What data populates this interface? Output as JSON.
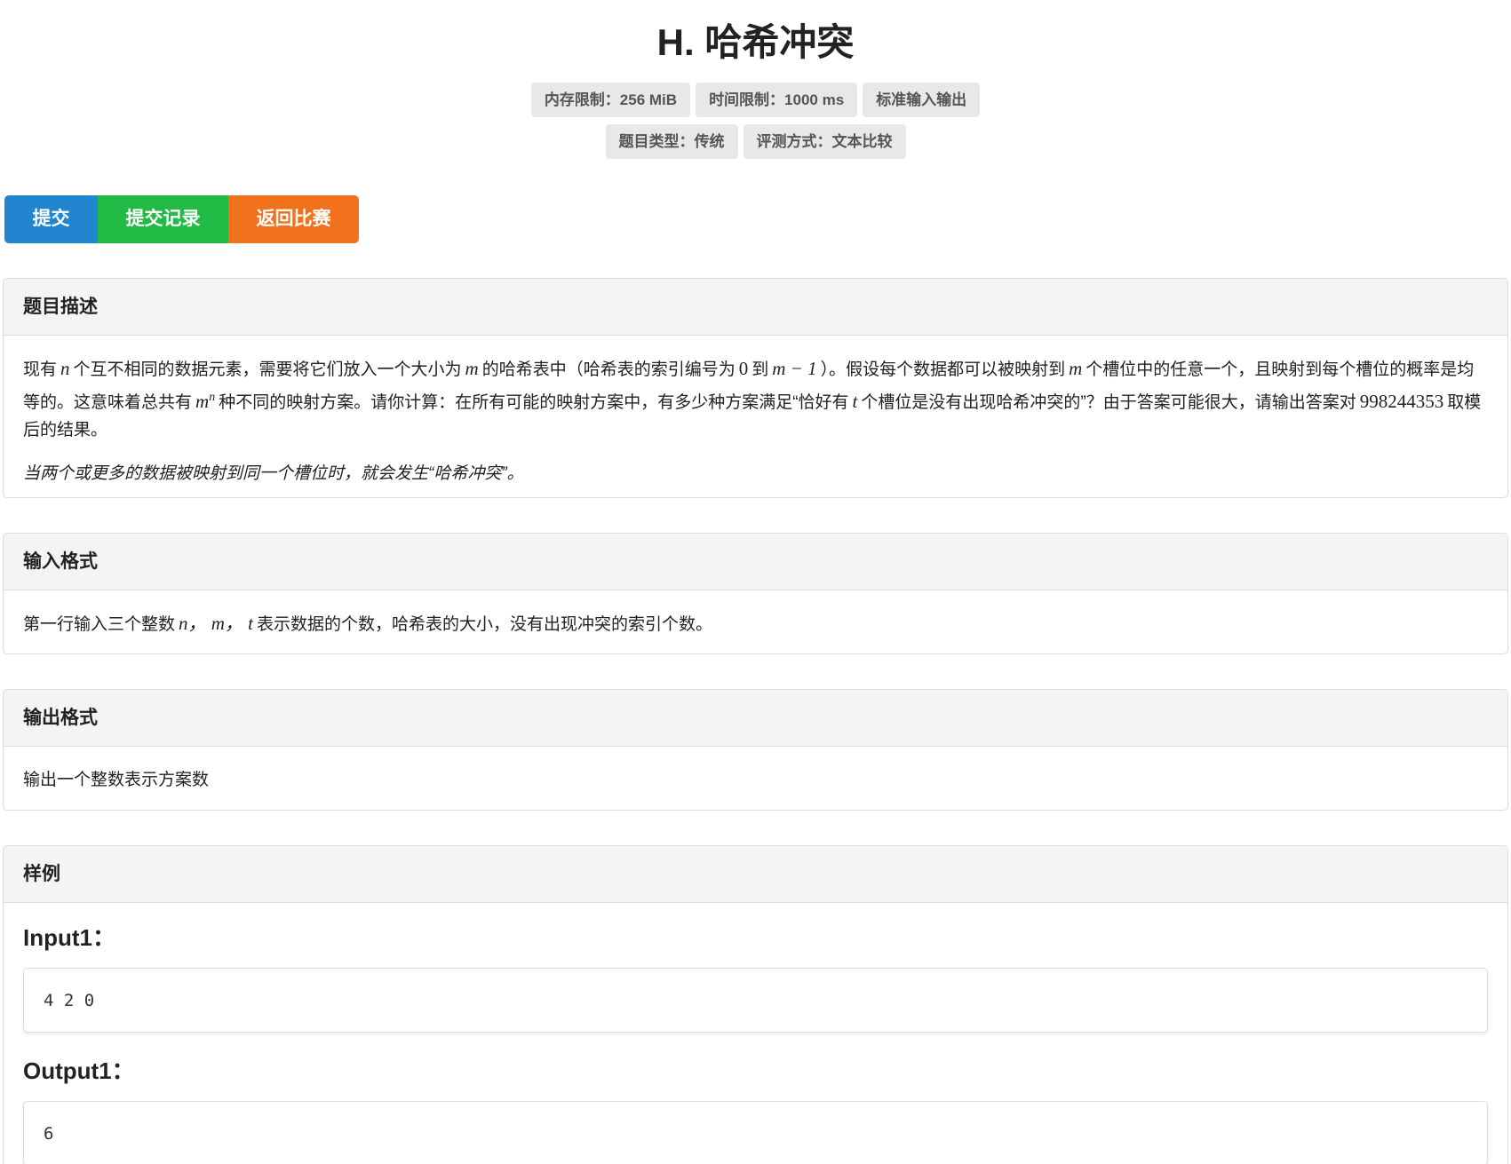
{
  "problem": {
    "title": "H. 哈希冲突",
    "badges_row1": [
      "内存限制：256 MiB",
      "时间限制：1000 ms",
      "标准输入输出"
    ],
    "badges_row2": [
      "题目类型：传统",
      "评测方式：文本比较"
    ]
  },
  "actions": {
    "submit": "提交",
    "records": "提交记录",
    "back": "返回比赛"
  },
  "description": {
    "heading": "题目描述",
    "text": {
      "t1": "现有",
      "n": "n",
      "t2": "个互不相同的数据元素，需要将它们放入一个大小为",
      "m": "m",
      "t3": "的哈希表中（哈希表的索引编号为",
      "zero": "0",
      "t4": "到",
      "m_minus_1": "m − 1",
      "t5": "）。假设每个数据都可以被映射到",
      "m2": "m",
      "t6": "个槽位中的任意一个，且映射到每个槽位的概率是均等的。这意味着总共有",
      "m_pow": "m",
      "n_sup": "n",
      "t7": "种不同的映射方案。请你计算：在所有可能的映射方案中，有多少种方案满足“恰好有",
      "t": "t",
      "t8": "个槽位是没有出现哈希冲突的”？由于答案可能很大，请输出答案对",
      "mod": "998244353",
      "t9": "取模后的结果。"
    },
    "note": "当两个或更多的数据被映射到同一个槽位时，就会发生“哈希冲突”。"
  },
  "input_format": {
    "heading": "输入格式",
    "t1": "第一行输入三个整数",
    "vars": "n， m， t",
    "t2": "表示数据的个数，哈希表的大小，没有出现冲突的索引个数。"
  },
  "output_format": {
    "heading": "输出格式",
    "text": "输出一个整数表示方案数"
  },
  "sample": {
    "heading": "样例",
    "input_label": "Input1：",
    "input_value": "4 2 0",
    "output_label": "Output1：",
    "output_value": "6"
  },
  "colors": {
    "submit": "#2185d0",
    "records": "#21ba45",
    "back": "#f2711c"
  }
}
